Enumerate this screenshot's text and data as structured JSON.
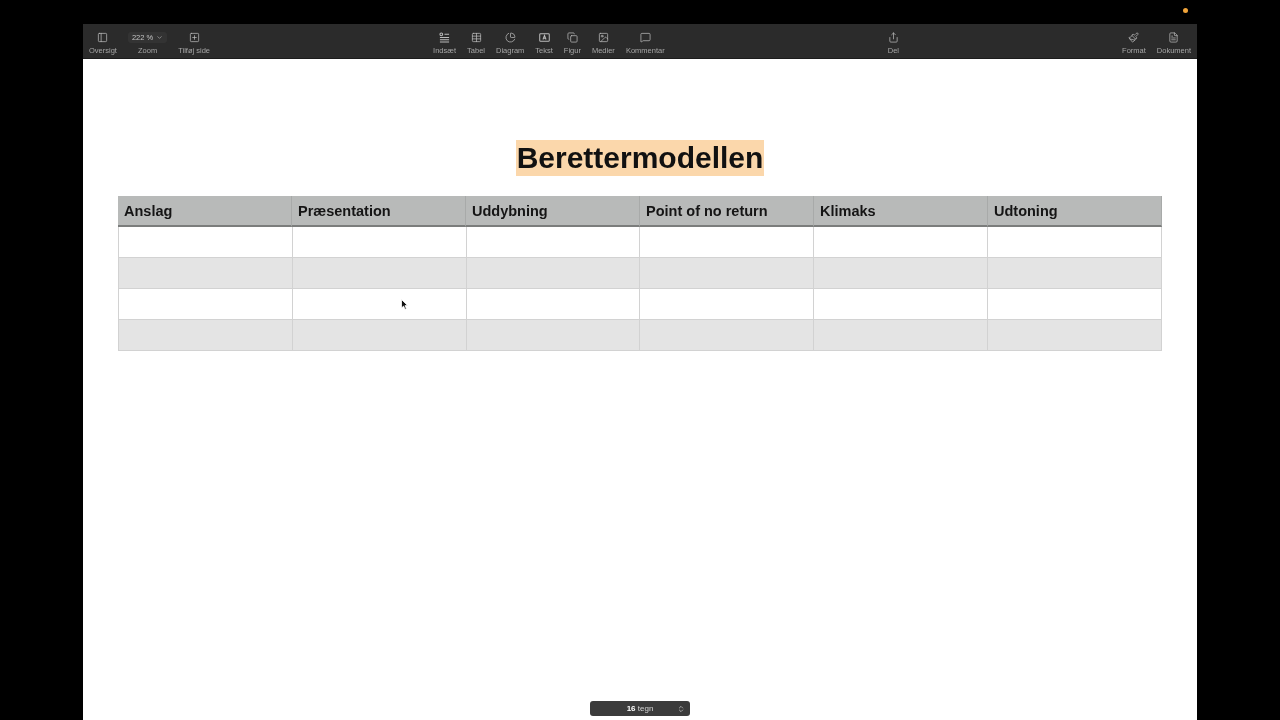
{
  "toolbar": {
    "view_items": [
      {
        "kind": "button",
        "label": "Oversigt"
      },
      {
        "kind": "dropdown",
        "value": "222 %",
        "label": "Zoom"
      },
      {
        "kind": "button",
        "label": "Tilføj side"
      }
    ],
    "insert_items": [
      {
        "kind": "button",
        "label": "Indsæt"
      },
      {
        "kind": "button",
        "label": "Tabel"
      },
      {
        "kind": "button",
        "label": "Diagram"
      },
      {
        "kind": "button",
        "label": "Tekst"
      },
      {
        "kind": "button",
        "label": "Figur"
      },
      {
        "kind": "button",
        "label": "Medier"
      },
      {
        "kind": "button",
        "label": "Kommentar"
      }
    ],
    "share_items": [
      {
        "kind": "button",
        "label": "Del"
      }
    ],
    "inspector_items": [
      {
        "kind": "button",
        "label": "Format"
      },
      {
        "kind": "button",
        "label": "Dokument"
      }
    ]
  },
  "document": {
    "title": {
      "text": "Berettermodellen",
      "highlighted": true
    },
    "table": {
      "columns": [
        "Anslag",
        "Præsentation",
        "Uddybning",
        "Point of no return",
        "Klimaks",
        "Udtoning"
      ],
      "rows": [
        {
          "shaded": false
        },
        {
          "shaded": true
        },
        {
          "shaded": false
        },
        {
          "shaded": true
        }
      ]
    }
  },
  "status_bar": {
    "count": "**16** tegn"
  }
}
